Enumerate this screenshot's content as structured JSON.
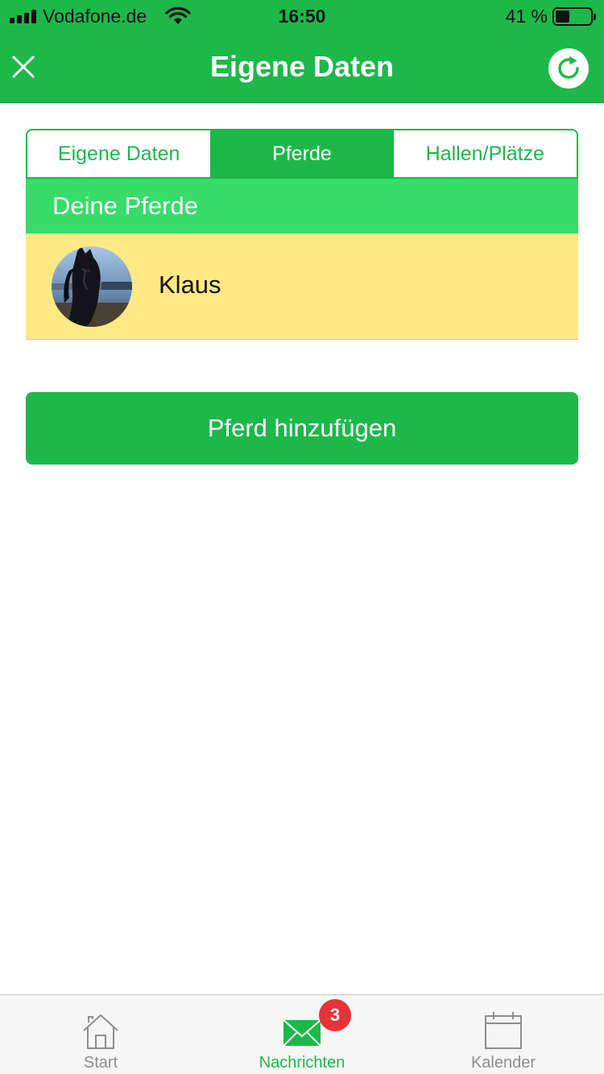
{
  "status_bar": {
    "carrier": "Vodafone.de",
    "time": "16:50",
    "battery_percent": "41 %",
    "battery_level": 0.41,
    "signal_icon": "signal-bars-icon",
    "wifi_icon": "wifi-icon"
  },
  "header": {
    "title": "Eigene Daten",
    "close_icon": "close-icon",
    "refresh_icon": "refresh-icon"
  },
  "tabs": [
    {
      "label": "Eigene Daten",
      "active": false
    },
    {
      "label": "Pferde",
      "active": true
    },
    {
      "label": "Hallen/Plätze",
      "active": false
    }
  ],
  "section": {
    "title": "Deine Pferde"
  },
  "horses": [
    {
      "name": "Klaus",
      "avatar_icon": "horse-avatar"
    }
  ],
  "add_button": {
    "label": "Pferd hinzufügen"
  },
  "tabbar": {
    "items": [
      {
        "label": "Start",
        "icon": "home-icon",
        "active": false
      },
      {
        "label": "Nachrichten",
        "icon": "envelope-icon",
        "active": true,
        "badge": "3"
      },
      {
        "label": "Kalender",
        "icon": "calendar-icon",
        "active": false
      }
    ]
  },
  "colors": {
    "primary_green": "#1db84a",
    "section_green": "#38dc6a",
    "highlight_row": "#fee985",
    "badge_red": "#e8323a"
  }
}
